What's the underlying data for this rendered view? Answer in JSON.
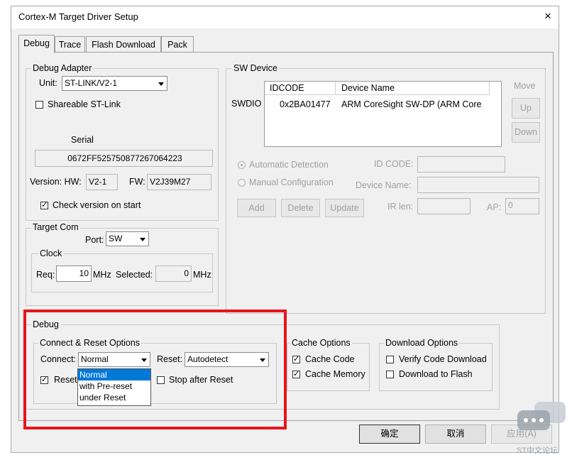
{
  "window": {
    "title": "Cortex-M Target Driver Setup",
    "close_glyph": "×"
  },
  "tabs": [
    "Debug",
    "Trace",
    "Flash Download",
    "Pack"
  ],
  "debug_adapter": {
    "group_label": "Debug Adapter",
    "unit_label": "Unit:",
    "unit_value": "ST-LINK/V2-1",
    "shareable_label": "Shareable ST-Link",
    "serial_label": "Serial",
    "serial_value": "0672FF525750877267064223",
    "version_hw_label": "Version: HW:",
    "hw_value": "V2-1",
    "fw_label": "FW:",
    "fw_value": "V2J39M27",
    "check_version_label": "Check version on start"
  },
  "target_com": {
    "group_label": "Target Com",
    "port_label": "Port:",
    "port_value": "SW",
    "clock_label": "Clock",
    "req_label": "Req:",
    "req_value": "10",
    "mhz1": "MHz",
    "selected_label": "Selected:",
    "selected_value": "0",
    "mhz2": "MHz"
  },
  "sw_device": {
    "group_label": "SW Device",
    "move_label": "Move",
    "up_label": "Up",
    "down_label": "Down",
    "swdio_label": "SWDIO",
    "col_idcode": "IDCODE",
    "col_device": "Device Name",
    "row_idcode": "0x2BA01477",
    "row_device": "ARM CoreSight SW-DP (ARM Core",
    "auto_label": "Automatic Detection",
    "manual_label": "Manual Configuration",
    "idcode_label": "ID CODE:",
    "device_name_label": "Device Name:",
    "add_label": "Add",
    "delete_label": "Delete",
    "update_label": "Update",
    "ir_len_label": "IR len:",
    "ap_label": "AP:",
    "ap_value": "0"
  },
  "debug_section": {
    "group_label": "Debug",
    "connect_reset_label": "Connect & Reset Options",
    "connect_label": "Connect:",
    "connect_value": "Normal",
    "reset_label": "Reset:",
    "reset_value": "Autodetect",
    "reset_after_label": "Reset",
    "stop_after_reset_label": "Stop after Reset",
    "dropdown_options": [
      "Normal",
      "with Pre-reset",
      "under Reset"
    ],
    "cache_label": "Cache Options",
    "cache_code_label": "Cache Code",
    "cache_memory_label": "Cache Memory",
    "download_label": "Download Options",
    "verify_label": "Verify Code Download",
    "download_flash_label": "Download to Flash"
  },
  "buttons": {
    "ok": "确定",
    "cancel": "取消",
    "apply": "应用(A)"
  },
  "watermark": "ST中文论坛",
  "colors": {
    "highlight": "#e8141b",
    "selection": "#0078d7"
  }
}
